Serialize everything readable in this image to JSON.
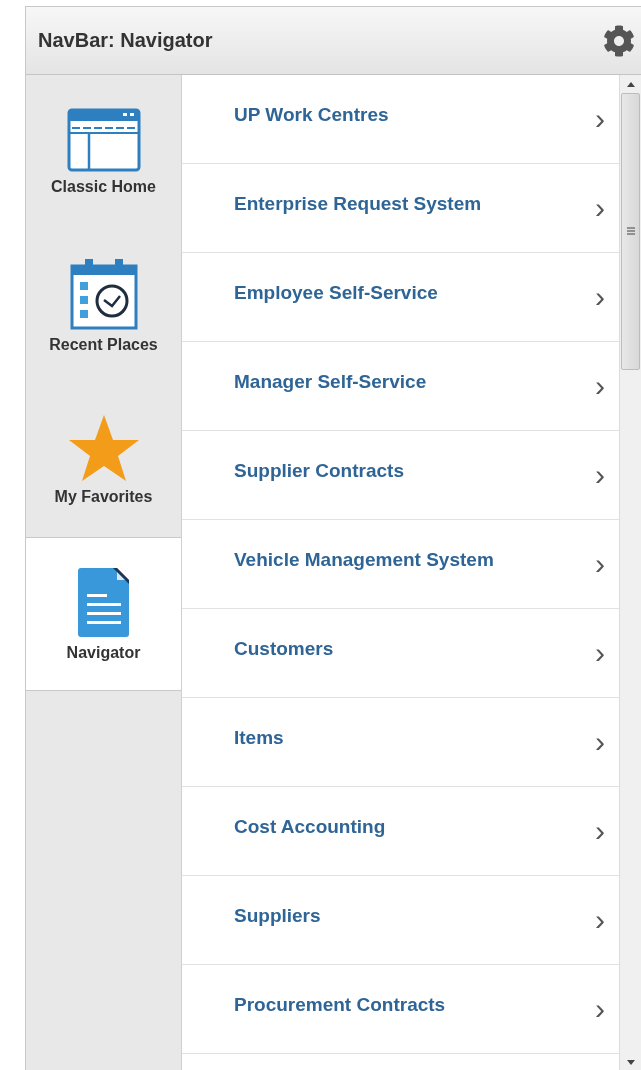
{
  "header": {
    "title": "NavBar: Navigator"
  },
  "sidebar": {
    "items": [
      {
        "kind": "classic-home",
        "label": "Classic Home",
        "selected": false
      },
      {
        "kind": "recent-places",
        "label": "Recent Places",
        "selected": false
      },
      {
        "kind": "favorites",
        "label": "My Favorites",
        "selected": false
      },
      {
        "kind": "navigator",
        "label": "Navigator",
        "selected": true
      }
    ]
  },
  "menu": {
    "items": [
      {
        "label": "UP Work Centres",
        "chevron": "›"
      },
      {
        "label": "Enterprise Request System",
        "chevron": "›"
      },
      {
        "label": "Employee Self-Service",
        "chevron": "›"
      },
      {
        "label": "Manager Self-Service",
        "chevron": "›"
      },
      {
        "label": "Supplier Contracts",
        "chevron": "›"
      },
      {
        "label": "Vehicle Management System",
        "chevron": "›"
      },
      {
        "label": "Customers",
        "chevron": "›"
      },
      {
        "label": "Items",
        "chevron": "›"
      },
      {
        "label": "Cost Accounting",
        "chevron": "›"
      },
      {
        "label": "Suppliers",
        "chevron": "›"
      },
      {
        "label": "Procurement Contracts",
        "chevron": "›"
      }
    ]
  }
}
